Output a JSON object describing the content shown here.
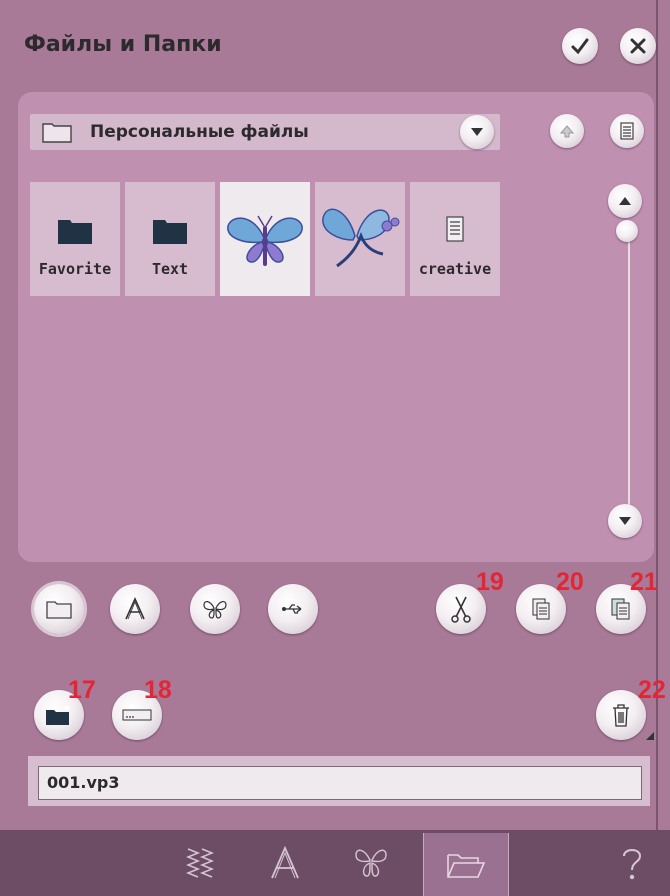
{
  "header": {
    "title": "Файлы и Папки"
  },
  "icons": {
    "confirm": "checkmark-icon",
    "close": "close-icon"
  },
  "directory": {
    "current": "Персональные файлы"
  },
  "files": [
    {
      "label": "Favorite",
      "type": "folder"
    },
    {
      "label": "Text",
      "type": "folder"
    },
    {
      "label": "",
      "type": "embroidery-butterfly",
      "selected": true
    },
    {
      "label": "",
      "type": "embroidery-butterfly-flower"
    },
    {
      "label": "creative",
      "type": "document"
    }
  ],
  "filters": [
    "folder-filter",
    "font-filter",
    "embroidery-filter",
    "usb-filter"
  ],
  "callouts": [
    "17",
    "18",
    "19",
    "20",
    "21",
    "22"
  ],
  "filename": {
    "value": "001.vp3"
  },
  "colors": {
    "background": "#a87a97",
    "panel": "#c090b0",
    "callout": "#e32636",
    "bottom_bar": "#6d4d66"
  }
}
